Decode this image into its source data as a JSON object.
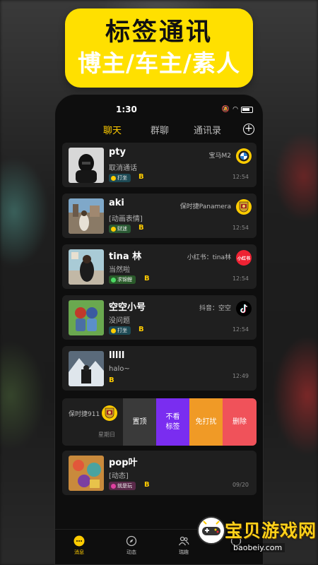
{
  "banner": {
    "line1": "标签通讯",
    "line2": "博主/车主/素人"
  },
  "status": {
    "time": "1:30"
  },
  "tabs": [
    {
      "label": "聊天",
      "active": true
    },
    {
      "label": "群聊",
      "active": false
    },
    {
      "label": "通讯录",
      "active": false
    }
  ],
  "chats": [
    {
      "name": "pty",
      "message": "取消通话",
      "tag": "打坐",
      "b": "B",
      "remark": "宝马M2",
      "time": "12:54",
      "brand_icon": "bmw-logo"
    },
    {
      "name": "aki",
      "message": "[动画表情]",
      "tag": "财迷",
      "b": "B",
      "remark": "保时捷Panamera",
      "time": "12:54",
      "brand_icon": "porsche-logo"
    },
    {
      "name": "tina 林",
      "message": "当然啦",
      "tag": "求锦鲤",
      "b": "B",
      "remark": "小红书：tina林",
      "time": "12:54",
      "brand_icon": "xiaohongshu-logo",
      "brand_text": "小红书"
    },
    {
      "name": "空空小号",
      "message": "没问题",
      "tag": "打坐",
      "b": "B",
      "remark": "抖音：空空",
      "time": "12:54",
      "brand_icon": "tiktok-logo"
    },
    {
      "name": "lllll",
      "message": "halo~",
      "b": "B",
      "time": "12:49"
    },
    {
      "name": "pop叶",
      "message": "[动态]",
      "tag": "就是玩",
      "b": "B",
      "time": "09/20"
    }
  ],
  "swiped": {
    "remark": "保时捷911",
    "time": "星期日",
    "actions": {
      "pin": "置顶",
      "hide1": "不看",
      "hide2": "标签",
      "mute": "免打扰",
      "delete": "删除"
    }
  },
  "bottom_nav": [
    {
      "label": "消息",
      "active": true,
      "icon": "message-icon"
    },
    {
      "label": "动态",
      "active": false,
      "icon": "compass-icon"
    },
    {
      "label": "瑞趣",
      "active": false,
      "icon": "people-icon"
    },
    {
      "label": "",
      "active": false,
      "icon": "profile-icon"
    }
  ],
  "watermark": {
    "title": "宝贝游戏网",
    "url": "baobeiy.com"
  },
  "colors": {
    "accent": "#ffcc00",
    "banner": "#ffe000",
    "pin": "#3a3a3a",
    "hide": "#7a2df0",
    "mute": "#f09a26",
    "delete": "#f0525a"
  }
}
